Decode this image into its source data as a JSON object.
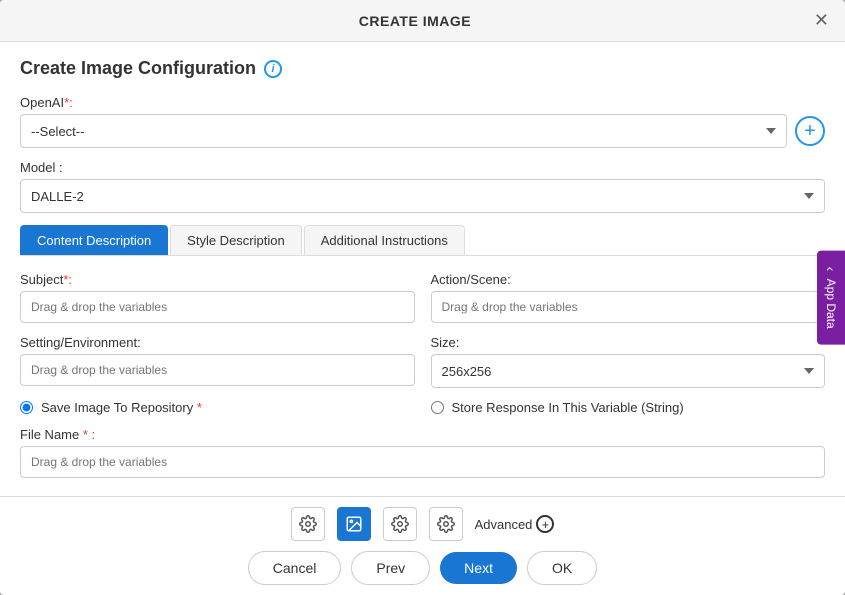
{
  "modal": {
    "title": "CREATE IMAGE"
  },
  "form": {
    "sectionTitle": "Create Image Configuration",
    "openaiLabel": "OpenAI",
    "openaiPlaceholder": "--Select--",
    "modelLabel": "Model :",
    "modelValue": "DALLE-2",
    "subjectLabel": "Subject",
    "actionSceneLabel": "Action/Scene:",
    "settingLabel": "Setting/Environment:",
    "sizeLabel": "Size:",
    "sizeValue": "256x256",
    "saveRepoLabel": "Save Image To Repository",
    "storeVarLabel": "Store Response In This Variable (String)",
    "fileNameLabel": "File Name",
    "dragDropPlaceholder": "Drag & drop the variables"
  },
  "tabs": [
    {
      "label": "Content Description"
    },
    {
      "label": "Style Description"
    },
    {
      "label": "Additional Instructions"
    }
  ],
  "footer": {
    "advancedLabel": "Advanced",
    "cancelLabel": "Cancel",
    "prevLabel": "Prev",
    "nextLabel": "Next",
    "okLabel": "OK"
  },
  "appDataTab": {
    "label": "App Data"
  }
}
